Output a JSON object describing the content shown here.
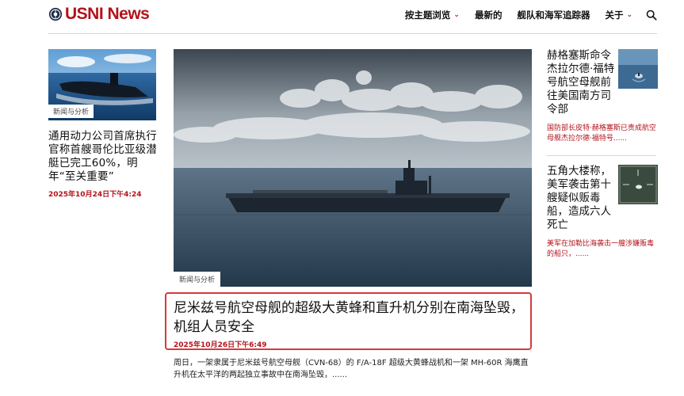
{
  "brand": {
    "name": "USNI News",
    "color": "#b3121b"
  },
  "nav": {
    "items": [
      {
        "label": "按主题浏览",
        "dropdown": true
      },
      {
        "label": "最新的",
        "dropdown": false
      },
      {
        "label": "舰队和海军追踪器",
        "dropdown": false
      },
      {
        "label": "关于",
        "dropdown": true
      }
    ],
    "search_icon": "search-icon"
  },
  "left_article": {
    "tag": "新闻与分析",
    "title": "通用动力公司首席执行官称首艘哥伦比亚级潜艇已完工60%，明年“至关重要”",
    "date": "2025年10月24日下午4:24",
    "image": "submarine-photo"
  },
  "main_article": {
    "tag": "新闻与分析",
    "title": "尼米兹号航空母舰的超级大黄蜂和直升机分别在南海坠毁，机组人员安全",
    "date": "2025年10月26日下午6:49",
    "excerpt": "周日，一架隶属于尼米兹号航空母舰（CVN-68）的 F/A-18F 超级大黄蜂战机和一架 MH-60R 海鹰直升机在太平洋的两起独立事故中在南海坠毁，......",
    "image": "aircraft-carrier-photo",
    "highlight_color": "#d63a3a"
  },
  "right_articles": [
    {
      "title": "赫格塞斯命令杰拉尔德·福特号航空母舰前往美国南方司令部",
      "excerpt": "国防部长皮特·赫格塞斯已责成航空母舰杰拉尔德·福特号......",
      "image": "ship-aerial-photo"
    },
    {
      "title": "五角大楼称，美军袭击第十艘疑似贩毒船，造成六人死亡",
      "excerpt": "美军在加勒比海袭击一艘涉嫌贩毒的船只，......",
      "image": "drone-strike-photo"
    }
  ]
}
